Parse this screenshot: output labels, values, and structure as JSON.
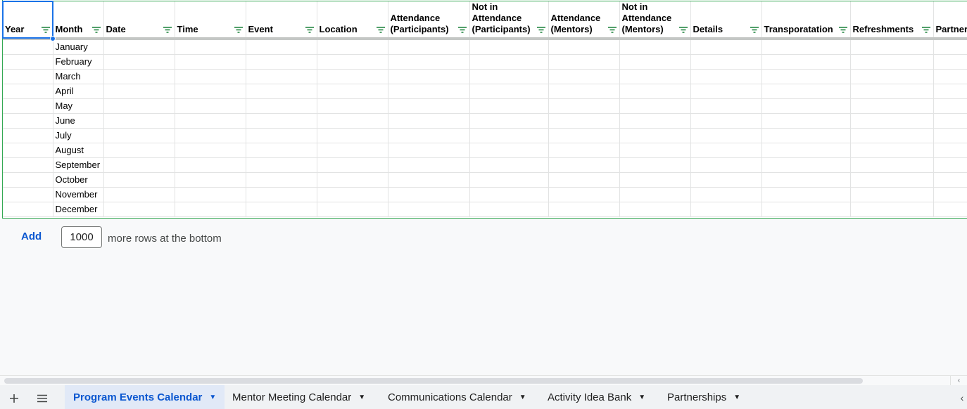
{
  "columns": [
    {
      "label": "Year",
      "width": 71
    },
    {
      "label": "Month",
      "width": 72
    },
    {
      "label": "Date",
      "width": 101
    },
    {
      "label": "Time",
      "width": 101
    },
    {
      "label": "Event",
      "width": 101
    },
    {
      "label": "Location",
      "width": 101
    },
    {
      "label": "Attendance (Participants)",
      "width": 116
    },
    {
      "label": "Not in Attendance (Participants)",
      "width": 112
    },
    {
      "label": "Attendance (Mentors)",
      "width": 101
    },
    {
      "label": "Not in Attendance (Mentors)",
      "width": 101
    },
    {
      "label": "Details",
      "width": 101
    },
    {
      "label": "Transporatation",
      "width": 126
    },
    {
      "label": "Refreshments",
      "width": 118
    },
    {
      "label": "Partner",
      "width": 60
    }
  ],
  "months": [
    "January",
    "February",
    "March",
    "April",
    "May",
    "June",
    "July",
    "August",
    "September",
    "October",
    "November",
    "December"
  ],
  "add_rows": {
    "button_label": "Add",
    "count": "1000",
    "suffix": "more rows at the bottom"
  },
  "sheet_tabs": [
    {
      "label": "Program Events Calendar",
      "active": true
    },
    {
      "label": "Mentor Meeting Calendar",
      "active": false
    },
    {
      "label": "Communications Calendar",
      "active": false
    },
    {
      "label": "Activity Idea Bank",
      "active": false
    },
    {
      "label": "Partnerships",
      "active": false
    }
  ],
  "colors": {
    "frozen_border": "#34a853",
    "selection": "#1a73e8",
    "active_tab_text": "#0b57d0",
    "active_tab_bg": "#e1e9f7",
    "filter_icon": "#188038"
  },
  "icons": {
    "add_sheet": "plus-icon",
    "all_sheets": "menu-lines-icon",
    "filter": "filter-icon",
    "tab_menu": "caret-down-icon"
  }
}
